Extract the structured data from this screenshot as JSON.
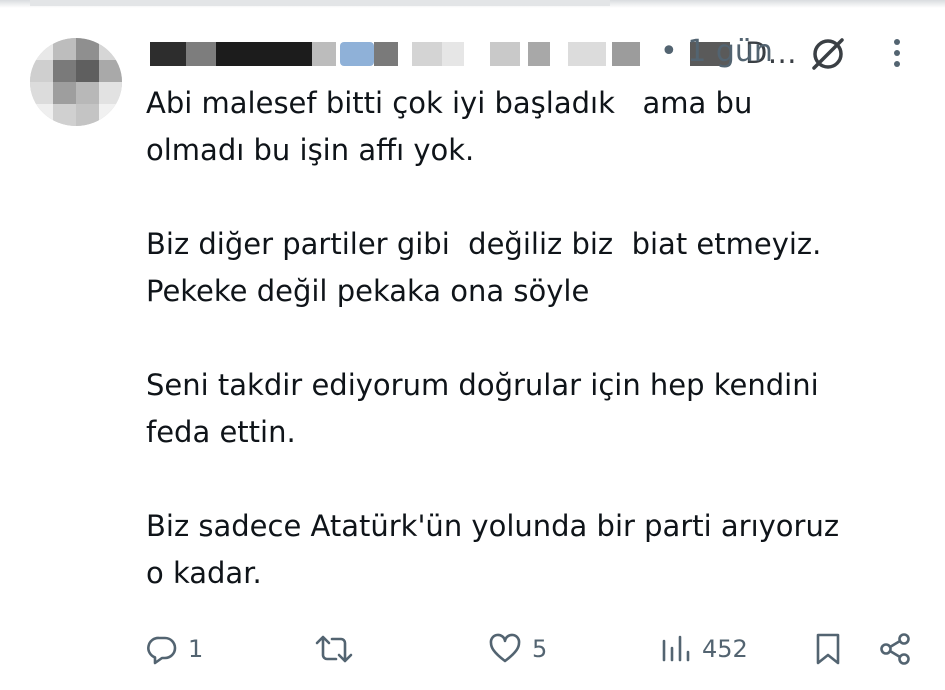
{
  "tweet": {
    "author_name_tail": "D...",
    "separator": "•",
    "timestamp": "1 gün",
    "body": [
      "Abi malesef bitti çok iyi başladık   ama bu\nolmadı bu işin affı yok.",
      "Biz diğer partiler gibi  değiliz biz  biat etmeyiz.\nPekeke değil pekaka ona söyle",
      "Seni takdir ediyorum doğrular için hep kendini\nfeda ettin.",
      "Biz sadece Atatürk'ün yolunda bir parti arıyoruz\no kadar."
    ]
  },
  "actions": {
    "reply_count": "1",
    "retweet_count": "",
    "like_count": "5",
    "view_count": "452"
  },
  "icons": {
    "reply": "reply-icon",
    "retweet": "retweet-icon",
    "like": "like-icon",
    "views": "views-icon",
    "bookmark": "bookmark-icon",
    "share": "share-icon",
    "grok": "grok-icon",
    "more": "more-icon"
  },
  "colors": {
    "text": "#0f1419",
    "secondary": "#536471",
    "verified": "#1d9bf0"
  }
}
